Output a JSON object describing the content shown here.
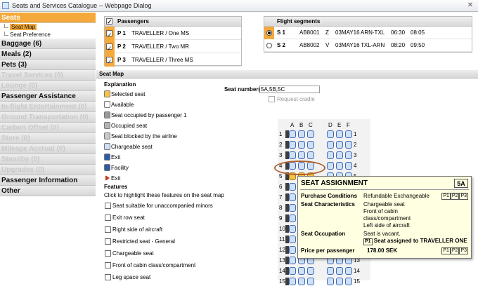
{
  "window": {
    "title": "Seats and Services Catalogue -- Webpage Dialog",
    "close_glyph": "✕"
  },
  "sidebar": {
    "items": [
      {
        "label": "Seats",
        "state": "active"
      },
      {
        "label": "Seat Map",
        "state": "sub-selected"
      },
      {
        "label": "Seat Preference",
        "state": "sub"
      },
      {
        "label": "Baggage (6)",
        "state": "enabled"
      },
      {
        "label": "Meals (2)",
        "state": "enabled"
      },
      {
        "label": "Pets (3)",
        "state": "enabled"
      },
      {
        "label": "Travel Services (0)",
        "state": "disabled"
      },
      {
        "label": "Lounge (0)",
        "state": "disabled"
      },
      {
        "label": "Passenger Assistance",
        "state": "enabled"
      },
      {
        "label": "In-flight Entertainment (0)",
        "state": "disabled"
      },
      {
        "label": "Ground Transportation (0)",
        "state": "disabled"
      },
      {
        "label": "Carbon Offset (0)",
        "state": "disabled"
      },
      {
        "label": "Store (0)",
        "state": "disabled"
      },
      {
        "label": "Mileage Accrual (0)",
        "state": "disabled"
      },
      {
        "label": "Standby (0)",
        "state": "disabled"
      },
      {
        "label": "Upgrades (0)",
        "state": "disabled"
      },
      {
        "label": "Passenger Information",
        "state": "enabled"
      },
      {
        "label": "Other",
        "state": "enabled"
      }
    ]
  },
  "passengers": {
    "header": "Passengers",
    "rows": [
      {
        "id": "P 1",
        "name": "TRAVELLER / One MS",
        "checked": true
      },
      {
        "id": "P 2",
        "name": "TRAVELLER / Two MR",
        "checked": true
      },
      {
        "id": "P 3",
        "name": "TRAVELLER / Three MS",
        "checked": true
      }
    ]
  },
  "flights": {
    "header": "Flight segments",
    "rows": [
      {
        "id": "S 1",
        "flight": "AB8001",
        "class": "Z",
        "date": "03MAY16",
        "route": "ARN-TXL",
        "dep": "06:30",
        "arr": "08:05",
        "selected": true
      },
      {
        "id": "S 2",
        "flight": "AB8002",
        "class": "V",
        "date": "03MAY16",
        "route": "TXL-ARN",
        "dep": "08:20",
        "arr": "09:50",
        "selected": false
      }
    ]
  },
  "seatmap": {
    "header": "Seat Map",
    "seat_number_label": "Seat number(s):",
    "seat_number_value": "5A,5B,5C",
    "request_cradle": "Request cradle",
    "explanation_title": "Explanation",
    "explanation": [
      {
        "label": "Selected seat",
        "color": "#f5c34a"
      },
      {
        "label": "Available",
        "color": "#ffffff"
      },
      {
        "label": "Seat occupied by passenger 1",
        "color": "#9a9a9a"
      },
      {
        "label": "Occupied seat",
        "color": "#b5b5b5"
      },
      {
        "label": "Seat blocked by the airline",
        "color": "#c8c8c8"
      },
      {
        "label": "Chargeable seat",
        "color": "#cfe0f7"
      },
      {
        "label": "Exit",
        "color": "#2e5aa8"
      },
      {
        "label": "Facility",
        "color": "#2e5aa8"
      },
      {
        "label": "Exit",
        "color": "#c23a1c"
      }
    ],
    "features_title": "Features",
    "features_sub": "Click to highlight these features on the seat map",
    "features": [
      "Seat suitable for unaccompanied minors",
      "Exit row seat",
      "Right side of aircraft",
      "Restricted seat - General",
      "Chargeable seat",
      "Front of cabin class/compartment",
      "Leg space seat"
    ],
    "columns_left": [
      "A",
      "B",
      "C"
    ],
    "columns_right": [
      "D",
      "E",
      "F"
    ],
    "rows": [
      "1",
      "2",
      "3",
      "4",
      "5",
      "6",
      "7",
      "8",
      "9",
      "10",
      "11",
      "12",
      "13",
      "14",
      "15"
    ]
  },
  "tooltip": {
    "title": "SEAT ASSIGNMENT",
    "seat": "5A",
    "purchase_label": "Purchase Conditions",
    "purchase_value": "Refundable  Exchangeable",
    "badges": [
      "P1",
      "P2",
      "P3"
    ],
    "characteristics_label": "Seat Characteristics",
    "characteristics": [
      "Chargeable seat",
      "Front of cabin",
      "class/compartment",
      "Left side of aircraft"
    ],
    "occupation_label": "Seat Occupation",
    "occupation_value": "Seat is vacant.",
    "occupation_badge": "P1",
    "occupation_note": "Seat assigned to TRAVELLER ONE",
    "price_label": "Price per passenger",
    "price_value": "178.00 SEK"
  }
}
